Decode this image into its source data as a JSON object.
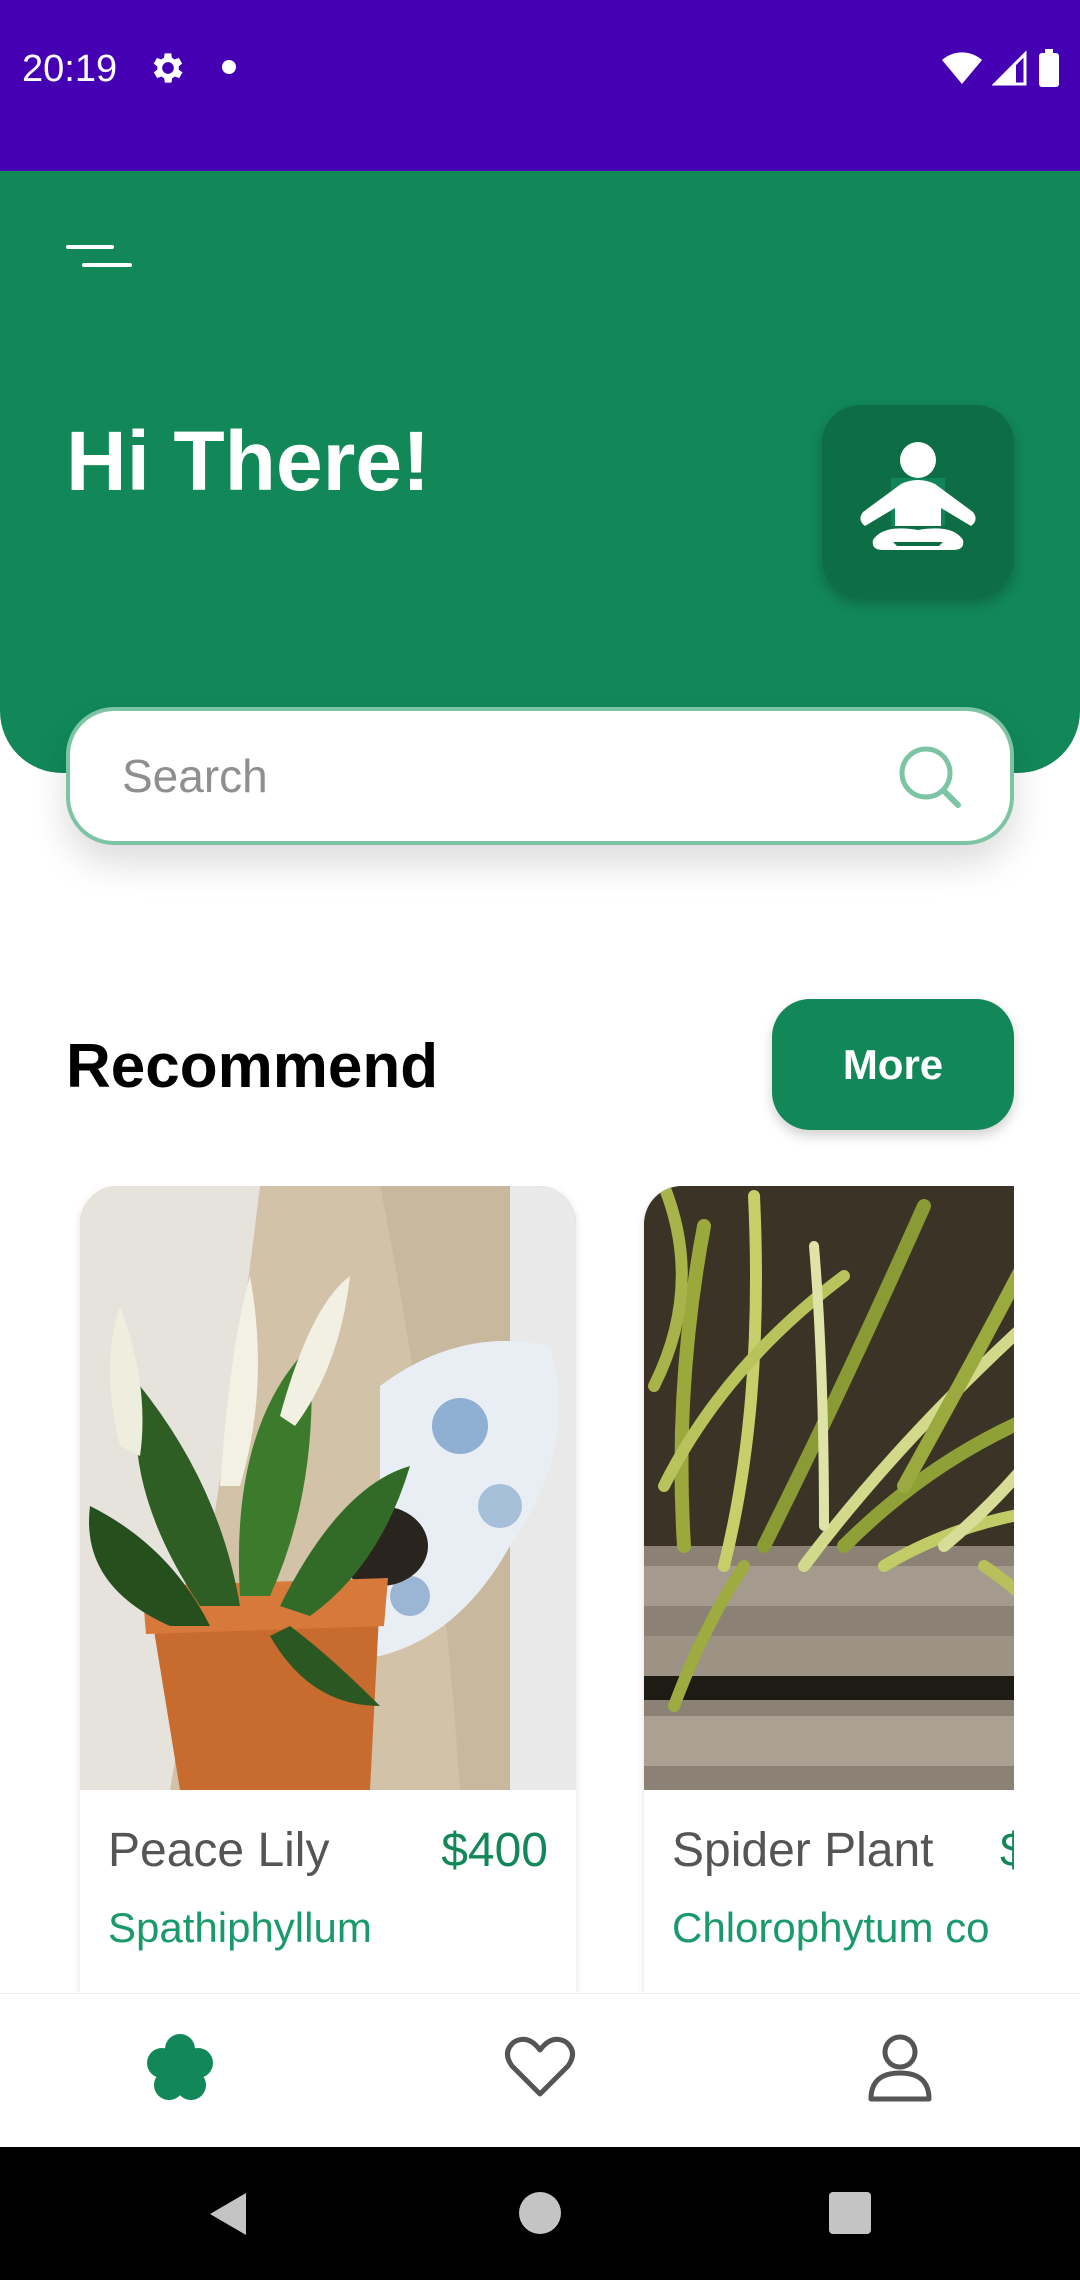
{
  "status_bar": {
    "time": "20:19",
    "icons": [
      "gear-icon",
      "dot-icon",
      "wifi-icon",
      "signal-icon",
      "battery-icon"
    ],
    "background": "#4400b2"
  },
  "header": {
    "menu_icon": "menu-icon",
    "greeting": "Hi There!",
    "avatar_icon": "meditation-icon",
    "background": "#128859"
  },
  "search": {
    "placeholder": "Search",
    "icon": "search-icon"
  },
  "recommend": {
    "title": "Recommend",
    "more_label": "More"
  },
  "cards": [
    {
      "name": "Peace Lily",
      "price": "$400",
      "scientific": "Spathiphyllum",
      "image": "peace-lily-photo"
    },
    {
      "name": "Spider Plant",
      "price": "$",
      "scientific": "Chlorophytum co",
      "image": "spider-plant-photo"
    }
  ],
  "bottom_nav": {
    "items": [
      {
        "icon": "flower-icon",
        "active": true
      },
      {
        "icon": "heart-icon",
        "active": false
      },
      {
        "icon": "user-icon",
        "active": false
      }
    ],
    "accent": "#128859"
  },
  "system_nav": {
    "buttons": [
      "back-icon",
      "home-icon",
      "recents-icon"
    ]
  }
}
